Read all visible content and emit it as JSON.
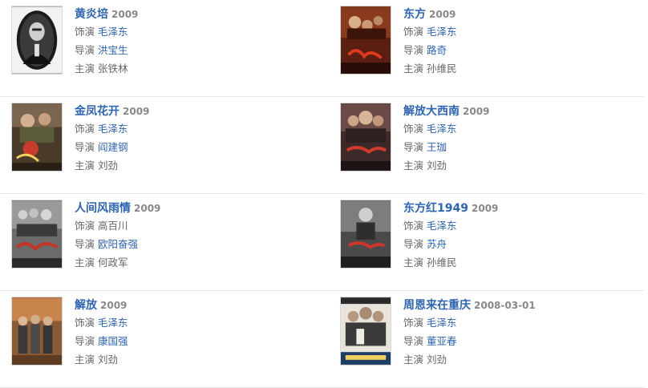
{
  "labels": {
    "role": "饰演",
    "director": "导演",
    "lead": "主演"
  },
  "films": [
    {
      "title": "黄炎培",
      "year": "2009",
      "role": "毛泽东",
      "director": "洪宝生",
      "lead": "张铁林"
    },
    {
      "title": "东方",
      "year": "2009",
      "role": "毛泽东",
      "director": "路奇",
      "lead": "孙维民"
    },
    {
      "title": "金凤花开",
      "year": "2009",
      "role": "毛泽东",
      "director": "阎建钢",
      "lead": "刘劲"
    },
    {
      "title": "解放大西南",
      "year": "2009",
      "role": "毛泽东",
      "director": "王珈",
      "lead": "刘劲"
    },
    {
      "title": "人间风雨情",
      "year": "2009",
      "role": "高百川",
      "director": "欧阳奋强",
      "lead": "何政军"
    },
    {
      "title": "东方红1949",
      "year": "2009",
      "role": "毛泽东",
      "director": "苏舟",
      "lead": "孙维民"
    },
    {
      "title": "解放",
      "year": "2009",
      "role": "毛泽东",
      "director": "康国强",
      "lead": "刘劲"
    },
    {
      "title": "周恩来在重庆",
      "year": "2008-03-01",
      "role": "毛泽东",
      "director": "董亚春",
      "lead": "刘劲"
    }
  ]
}
